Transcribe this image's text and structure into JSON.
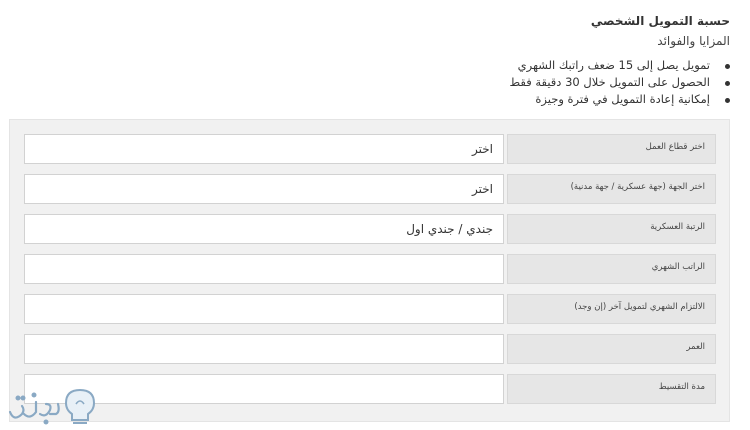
{
  "header": {
    "title": "حسبة التمويل الشخصي",
    "subtitle": "المزايا والفوائد"
  },
  "benefits": [
    "تمويل يصل إلى 15 ضعف راتبك الشهري",
    "الحصول على التمويل خلال 30 دقيقة فقط",
    "إمكانية إعادة التمويل في فترة وجيزة"
  ],
  "form": {
    "fields": [
      {
        "label": "اختر قطاع العمل",
        "value": "اختر"
      },
      {
        "label": "اختر الجهة (جهة عسكرية / جهة مدنية)",
        "value": "اختر"
      },
      {
        "label": "الرتبة العسكرية",
        "value": "جندي / جندي اول"
      },
      {
        "label": "الراتب الشهري",
        "value": ""
      },
      {
        "label": "الالتزام الشهري لتمويل آخر (إن وجد)",
        "value": ""
      },
      {
        "label": "العمر",
        "value": ""
      },
      {
        "label": "مدة التقسيط",
        "value": ""
      }
    ]
  },
  "watermark": {
    "text": "ثقفني",
    "icon": "lightbulb-icon",
    "color": "#8aa9c4"
  }
}
